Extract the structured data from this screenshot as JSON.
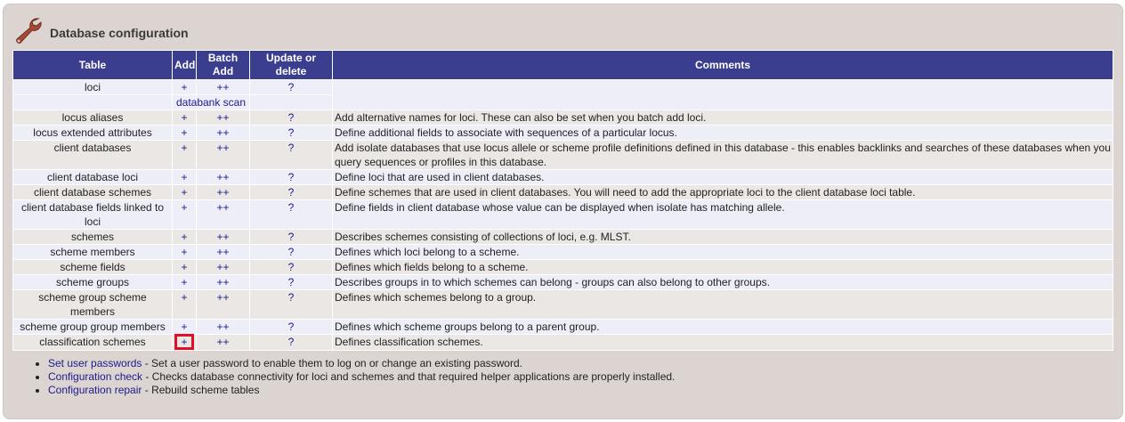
{
  "page": {
    "title": "Database configuration"
  },
  "table": {
    "headers": {
      "table": "Table",
      "add": "Add",
      "batch_add": "Batch Add",
      "update_delete": "Update or delete",
      "comments": "Comments"
    },
    "rows": [
      {
        "name": "loci",
        "add": "+",
        "batch": "++",
        "update": "?",
        "extra": "databank scan",
        "comment": ""
      },
      {
        "name": "locus aliases",
        "add": "+",
        "batch": "++",
        "update": "?",
        "comment": "Add alternative names for loci. These can also be set when you batch add loci."
      },
      {
        "name": "locus extended attributes",
        "add": "+",
        "batch": "++",
        "update": "?",
        "comment": "Define additional fields to associate with sequences of a particular locus."
      },
      {
        "name": "client databases",
        "add": "+",
        "batch": "++",
        "update": "?",
        "comment": "Add isolate databases that use locus allele or scheme profile definitions defined in this database - this enables backlinks and searches of these databases when you query sequences or profiles in this database."
      },
      {
        "name": "client database loci",
        "add": "+",
        "batch": "++",
        "update": "?",
        "comment": "Define loci that are used in client databases."
      },
      {
        "name": "client database schemes",
        "add": "+",
        "batch": "++",
        "update": "?",
        "comment": "Define schemes that are used in client databases. You will need to add the appropriate loci to the client database loci table."
      },
      {
        "name": "client database fields linked to loci",
        "add": "+",
        "batch": "++",
        "update": "?",
        "comment": "Define fields in client database whose value can be displayed when isolate has matching allele."
      },
      {
        "name": "schemes",
        "add": "+",
        "batch": "++",
        "update": "?",
        "comment": "Describes schemes consisting of collections of loci, e.g. MLST."
      },
      {
        "name": "scheme members",
        "add": "+",
        "batch": "++",
        "update": "?",
        "comment": "Defines which loci belong to a scheme."
      },
      {
        "name": "scheme fields",
        "add": "+",
        "batch": "++",
        "update": "?",
        "comment": "Defines which fields belong to a scheme."
      },
      {
        "name": "scheme groups",
        "add": "+",
        "batch": "++",
        "update": "?",
        "comment": "Describes groups in to which schemes can belong - groups can also belong to other groups."
      },
      {
        "name": "scheme group scheme members",
        "add": "+",
        "batch": "++",
        "update": "?",
        "comment": "Defines which schemes belong to a group."
      },
      {
        "name": "scheme group group members",
        "add": "+",
        "batch": "++",
        "update": "?",
        "comment": "Defines which scheme groups belong to a parent group."
      },
      {
        "name": "classification schemes",
        "add": "+",
        "batch": "++",
        "update": "?",
        "comment": "Defines classification schemes."
      }
    ]
  },
  "links": [
    {
      "label": "Set user passwords",
      "text": " - Set a user password to enable them to log on or change an existing password."
    },
    {
      "label": "Configuration check",
      "text": " - Checks database connectivity for loci and schemes and that required helper applications are properly installed."
    },
    {
      "label": "Configuration repair",
      "text": " - Rebuild scheme tables"
    }
  ],
  "colors": {
    "header_bg": "#3b3d8f",
    "highlight": "#e0102a",
    "link": "#1b1b8a"
  },
  "icons": {
    "header": "wrench-icon"
  }
}
